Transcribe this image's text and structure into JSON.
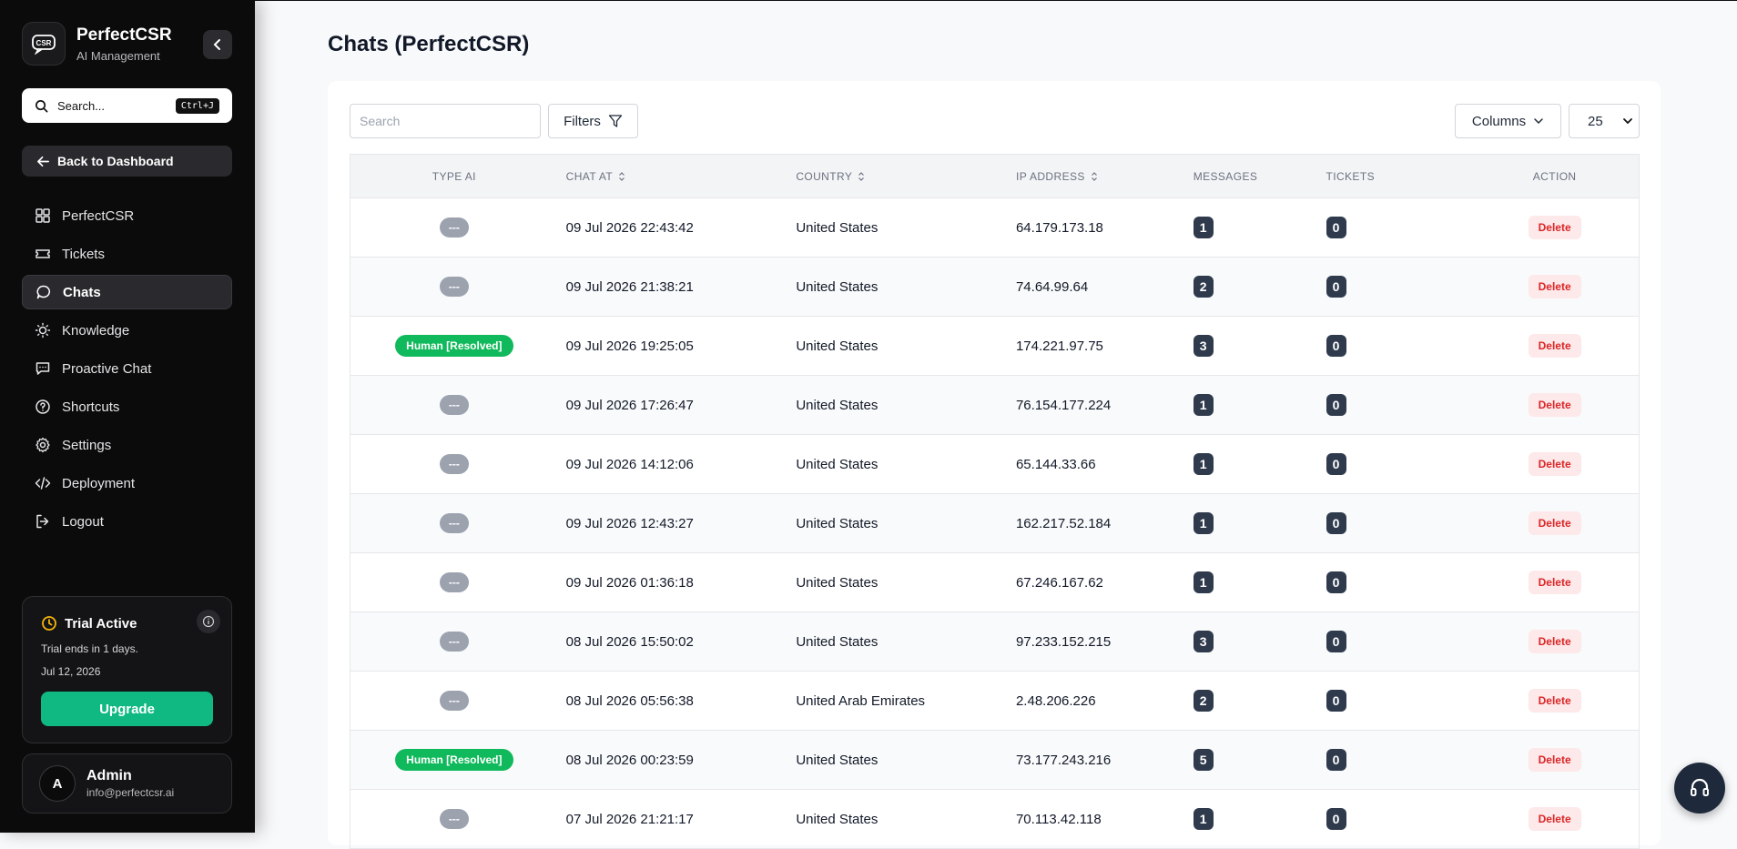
{
  "brand": {
    "name": "PerfectCSR",
    "subtitle": "AI Management",
    "logo_text": "CSR"
  },
  "sidebar": {
    "search_placeholder": "Search...",
    "search_shortcut": "Ctrl+J",
    "back_label": "Back to Dashboard",
    "items": [
      {
        "label": "PerfectCSR",
        "icon": "grid-icon",
        "active": false
      },
      {
        "label": "Tickets",
        "icon": "ticket-icon",
        "active": false
      },
      {
        "label": "Chats",
        "icon": "chat-icon",
        "active": true
      },
      {
        "label": "Knowledge",
        "icon": "lightbulb-icon",
        "active": false
      },
      {
        "label": "Proactive Chat",
        "icon": "message-square-icon",
        "active": false
      },
      {
        "label": "Shortcuts",
        "icon": "help-circle-icon",
        "active": false
      },
      {
        "label": "Settings",
        "icon": "gear-icon",
        "active": false
      },
      {
        "label": "Deployment",
        "icon": "code-icon",
        "active": false
      },
      {
        "label": "Logout",
        "icon": "logout-icon",
        "active": false
      }
    ],
    "trial": {
      "title": "Trial Active",
      "ends_text": "Trial ends in 1 days.",
      "date": "Jul 12, 2026",
      "upgrade_label": "Upgrade"
    },
    "user": {
      "initial": "A",
      "name": "Admin",
      "email": "info@perfectcsr.ai"
    }
  },
  "page": {
    "title": "Chats (PerfectCSR)"
  },
  "toolbar": {
    "search_placeholder": "Search",
    "filters_label": "Filters",
    "columns_label": "Columns",
    "per_page": "25"
  },
  "table": {
    "headers": {
      "type_ai": "TYPE AI",
      "chat_at": "CHAT AT",
      "country": "COUNTRY",
      "ip": "IP ADDRESS",
      "messages": "MESSAGES",
      "tickets": "TICKETS",
      "action": "ACTION"
    },
    "rows": [
      {
        "type": "---",
        "human": false,
        "chat_at": "09 Jul 2026 22:43:42",
        "country": "United States",
        "ip": "64.179.173.18",
        "messages": "1",
        "tickets": "0",
        "action": "Delete"
      },
      {
        "type": "---",
        "human": false,
        "chat_at": "09 Jul 2026 21:38:21",
        "country": "United States",
        "ip": "74.64.99.64",
        "messages": "2",
        "tickets": "0",
        "action": "Delete"
      },
      {
        "type": "Human [Resolved]",
        "human": true,
        "chat_at": "09 Jul 2026 19:25:05",
        "country": "United States",
        "ip": "174.221.97.75",
        "messages": "3",
        "tickets": "0",
        "action": "Delete"
      },
      {
        "type": "---",
        "human": false,
        "chat_at": "09 Jul 2026 17:26:47",
        "country": "United States",
        "ip": "76.154.177.224",
        "messages": "1",
        "tickets": "0",
        "action": "Delete"
      },
      {
        "type": "---",
        "human": false,
        "chat_at": "09 Jul 2026 14:12:06",
        "country": "United States",
        "ip": "65.144.33.66",
        "messages": "1",
        "tickets": "0",
        "action": "Delete"
      },
      {
        "type": "---",
        "human": false,
        "chat_at": "09 Jul 2026 12:43:27",
        "country": "United States",
        "ip": "162.217.52.184",
        "messages": "1",
        "tickets": "0",
        "action": "Delete"
      },
      {
        "type": "---",
        "human": false,
        "chat_at": "09 Jul 2026 01:36:18",
        "country": "United States",
        "ip": "67.246.167.62",
        "messages": "1",
        "tickets": "0",
        "action": "Delete"
      },
      {
        "type": "---",
        "human": false,
        "chat_at": "08 Jul 2026 15:50:02",
        "country": "United States",
        "ip": "97.233.152.215",
        "messages": "3",
        "tickets": "0",
        "action": "Delete"
      },
      {
        "type": "---",
        "human": false,
        "chat_at": "08 Jul 2026 05:56:38",
        "country": "United Arab Emirates",
        "ip": "2.48.206.226",
        "messages": "2",
        "tickets": "0",
        "action": "Delete"
      },
      {
        "type": "Human [Resolved]",
        "human": true,
        "chat_at": "08 Jul 2026 00:23:59",
        "country": "United States",
        "ip": "73.177.243.216",
        "messages": "5",
        "tickets": "0",
        "action": "Delete"
      },
      {
        "type": "---",
        "human": false,
        "chat_at": "07 Jul 2026 21:21:17",
        "country": "United States",
        "ip": "70.113.42.118",
        "messages": "1",
        "tickets": "0",
        "action": "Delete"
      }
    ]
  },
  "colors": {
    "accent_green": "#10b981",
    "human_badge": "#10b95b",
    "delete_red": "#dc2626",
    "count_badge": "#2f3b4d",
    "sidebar_bg": "#0b0b0c"
  },
  "fab": {
    "icon": "headset-icon"
  }
}
